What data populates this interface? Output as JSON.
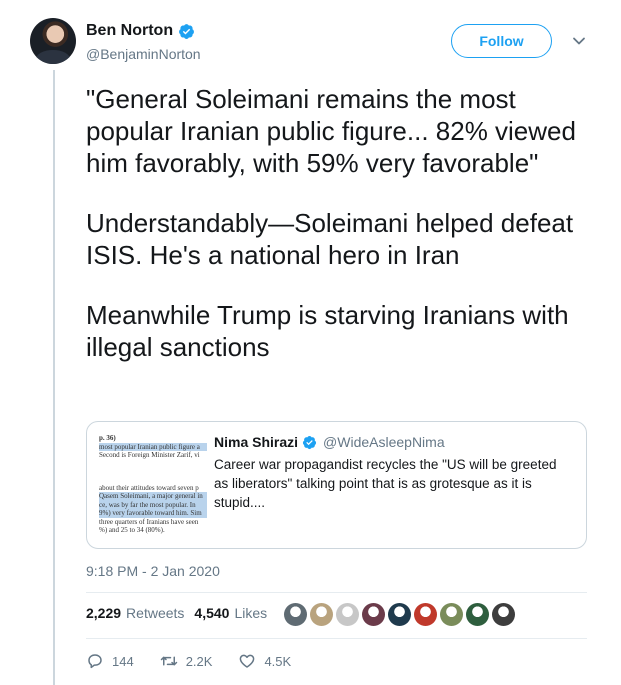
{
  "author": {
    "display_name": "Ben Norton",
    "handle": "@BenjaminNorton",
    "verified": true
  },
  "follow_label": "Follow",
  "tweet": {
    "paragraphs": [
      "\"General Soleimani remains the most popular Iranian public figure... 82% viewed him favorably, with 59% very favorable\"",
      "Understandably—Soleimani helped defeat ISIS. He's a national hero in Iran",
      "Meanwhile Trump is starving Iranians with illegal sanctions"
    ]
  },
  "quoted_tweet": {
    "display_name": "Nima Shirazi",
    "handle": "@WideAsleepNima",
    "verified": true,
    "text": "Career war propagandist recycles the \"US will be greeted as liberators\" talking point that is as grotesque as it is stupid....",
    "image_lines_top": [
      "p. 36)",
      "most popular Iranian public figure a",
      "Second is Foreign Minister Zarif, vi"
    ],
    "image_lines_bottom": [
      "about their attitudes toward seven p",
      "Qasem Soleimani, a major general in",
      "ce, was by far the most popular. In",
      "9%) very favorable toward him. Sim",
      "three quarters of Iranians have seen",
      "%) and 25 to 34 (80%)."
    ]
  },
  "timestamp": "9:18 PM - 2 Jan 2020",
  "stats": {
    "retweets_count": "2,229",
    "retweets_label": "Retweets",
    "likes_count": "4,540",
    "likes_label": "Likes"
  },
  "liker_avatar_colors": [
    "#5f6b73",
    "#b9a37e",
    "#c7c7c7",
    "#6b3b4a",
    "#1f3a4d",
    "#c0392b",
    "#7a8c5a",
    "#2e5e3e",
    "#3d3d3d"
  ],
  "actions": {
    "replies": "144",
    "retweets": "2.2K",
    "likes": "4.5K"
  },
  "colors": {
    "accent": "#1da1f2",
    "secondary_text": "#657786",
    "border": "#ccd6dd"
  }
}
